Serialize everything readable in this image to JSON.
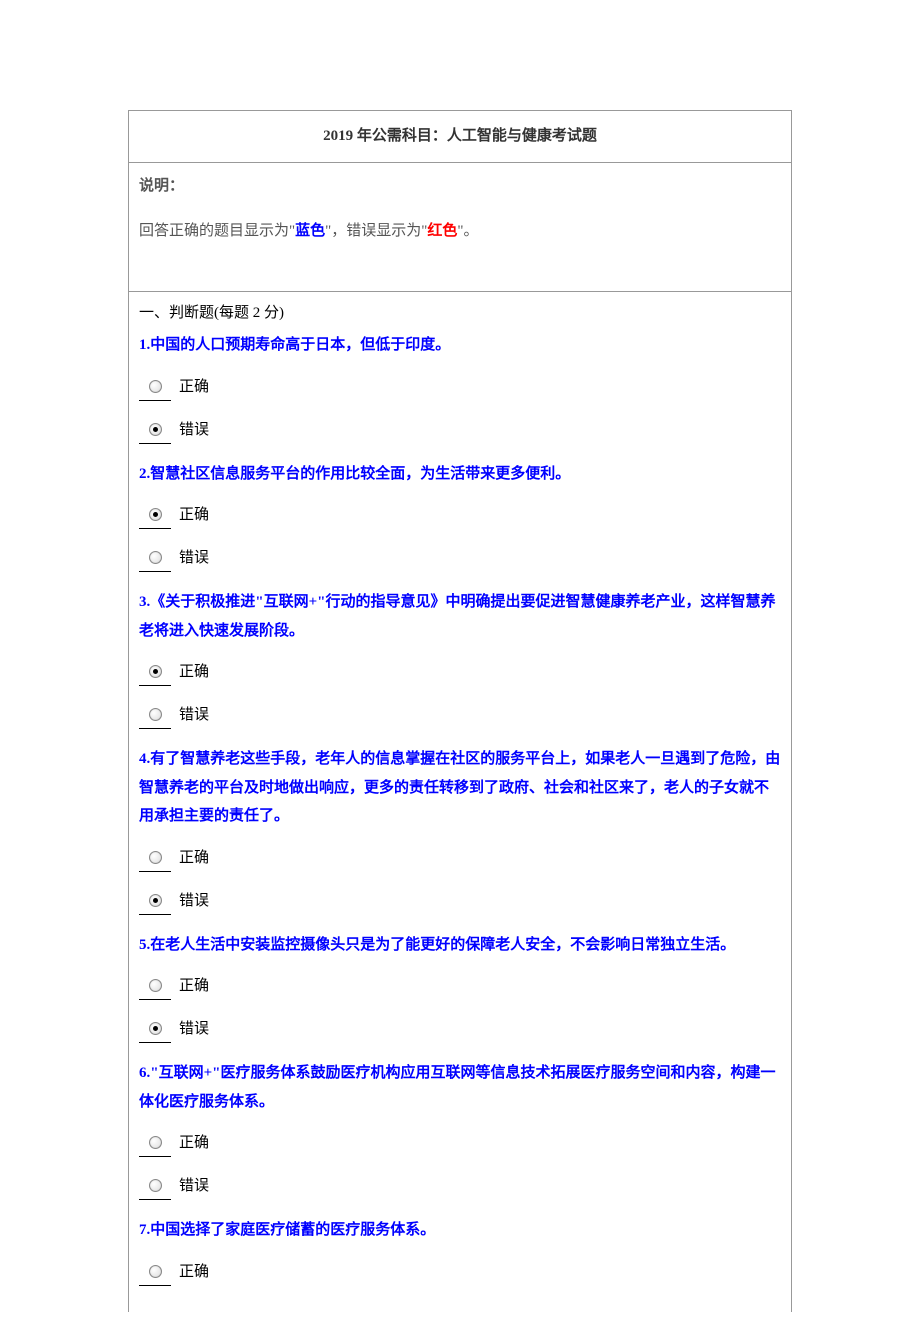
{
  "title": "2019 年公需科目：人工智能与健康考试题",
  "instruction": {
    "label": "说明：",
    "prefix": "回答正确的题目显示为\"",
    "blue": "蓝色",
    "middle": "\"，错误显示为\"",
    "red": "红色",
    "suffix": "\"。"
  },
  "section_header": "一、判断题(每题 2 分)",
  "option_correct": "正确",
  "option_wrong": "错误",
  "questions": [
    {
      "num": "1.",
      "text": "中国的人口预期寿命高于日本，但低于印度。",
      "selected": "wrong"
    },
    {
      "num": "2.",
      "text": "智慧社区信息服务平台的作用比较全面，为生活带来更多便利。",
      "selected": "correct"
    },
    {
      "num": "3.",
      "text": "《关于积极推进\"互联网+\"行动的指导意见》中明确提出要促进智慧健康养老产业，这样智慧养老将进入快速发展阶段。",
      "selected": "correct"
    },
    {
      "num": "4.",
      "text": "有了智慧养老这些手段，老年人的信息掌握在社区的服务平台上，如果老人一旦遇到了危险，由智慧养老的平台及时地做出响应，更多的责任转移到了政府、社会和社区来了，老人的子女就不用承担主要的责任了。",
      "selected": "wrong"
    },
    {
      "num": "5.",
      "text": "在老人生活中安装监控摄像头只是为了能更好的保障老人安全，不会影响日常独立生活。",
      "selected": "wrong"
    },
    {
      "num": "6.",
      "text": "\"互联网+\"医疗服务体系鼓励医疗机构应用互联网等信息技术拓展医疗服务空间和内容，构建一体化医疗服务体系。",
      "selected": "none"
    },
    {
      "num": "7.",
      "text": "中国选择了家庭医疗储蓄的医疗服务体系。",
      "selected": "none",
      "only_correct": true
    }
  ]
}
